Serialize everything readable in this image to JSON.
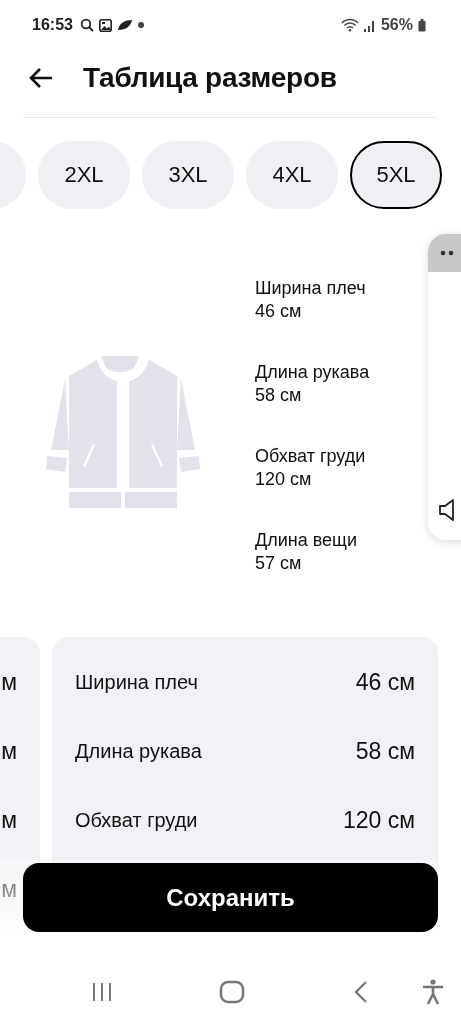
{
  "status_bar": {
    "time": "16:53",
    "battery": "56%"
  },
  "header": {
    "title": "Таблица размеров"
  },
  "sizes": [
    {
      "label": "2XL",
      "selected": false
    },
    {
      "label": "3XL",
      "selected": false
    },
    {
      "label": "4XL",
      "selected": false
    },
    {
      "label": "5XL",
      "selected": true
    }
  ],
  "measurements": [
    {
      "label": "Ширина плеч",
      "value": "46 см"
    },
    {
      "label": "Длина рукава",
      "value": "58 см"
    },
    {
      "label": "Обхват груди",
      "value": "120 см"
    },
    {
      "label": "Длина вещи",
      "value": "57 см"
    }
  ],
  "table_cards": [
    {
      "rows": [
        {
          "value": "м"
        },
        {
          "value": "м"
        },
        {
          "value": "м"
        },
        {
          "value": "м"
        }
      ]
    },
    {
      "rows": [
        {
          "label": "Ширина плеч",
          "value": "46 см"
        },
        {
          "label": "Длина рукава",
          "value": "58 см"
        },
        {
          "label": "Обхват груди",
          "value": "120 см"
        }
      ]
    }
  ],
  "save_button": {
    "label": "Сохранить"
  }
}
